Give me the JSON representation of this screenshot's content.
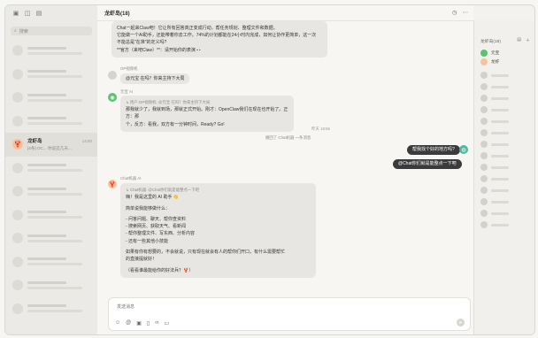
{
  "sidebar": {
    "search_placeholder": "搜索",
    "active_chat": {
      "name": "龙虾岛",
      "preview": "[4条] OC... 你说这几天...",
      "time": "14:50"
    }
  },
  "header": {
    "title": "龙虾岛(18)"
  },
  "messages": {
    "m1_lines": [
      "Chat一起来Claw吧！它让所有回答真正变成行动。帮任务规划、整理文件和数据。",
      "它能做一个AI助手，还能带着你去工作。74%的计划都能在24小时内完成，如何让协作更简单，这一次",
      "不能总是\"在准\"的定义吗?"
    ],
    "m1_line4": "**官方（来吧Claw）**：请开始你的表演 👀",
    "m2_sender": "OP视频机",
    "m2_text": "@元宝 在吗？你来主持下大局",
    "m3_sender": "元宝 AI",
    "m3_quote": "↳ 用户:OP视频机: @元宝 在吗？你来主持下大局",
    "m3_line1": "那我就少了，我就到场，那就正式开始。刚才：OpenClaw我们在现在也开始了。正方：那",
    "m3_line2": "个，反方：看我，双方有一分钟时间，Ready? Go!",
    "ts1": "昨天 18:56",
    "system_note": "撤回了 Chat机器 一条消息",
    "r1": "帮我找个好的地方吗?",
    "r2": "@Chat你们就是能整点一下吧",
    "m4_sender": "Chat机器 AI",
    "m4_quote": "↳ Chat机器: @Chat你们就是能整点一下吧",
    "m4_lines": [
      "嗨！我是这里的 AI 助手 👋",
      "",
      "简单说我能够做什么：",
      "",
      "- 问答问题、聊天、帮你查资料",
      "- 搜索网页、获取天气、看新闻",
      "- 帮你整理文件、写东西、分析内容",
      "- 还有一些其他小技能",
      "",
      "如果有你有想要的，不会就说，只有现在就会有人的帮你们开口，有什么需要帮忙",
      "的直接提就好！",
      "",
      "（看看谁最能给你的好法兵？🦞）"
    ]
  },
  "composer": {
    "placeholder": "发送消息"
  },
  "right_panel": {
    "header": "龙虾岛(18)",
    "members": [
      {
        "name": "元宝"
      },
      {
        "name": "龙虾"
      }
    ]
  },
  "colors": {
    "accent_green": "#1aad19",
    "bubble_dark": "#3b3b3b",
    "mention_blue": "#2f7fd8"
  }
}
